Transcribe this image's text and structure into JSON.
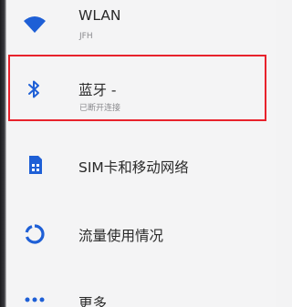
{
  "settings": {
    "items": [
      {
        "id": "wlan",
        "icon": "wifi-icon",
        "title": "WLAN",
        "subtitle": "JFH"
      },
      {
        "id": "bluetooth",
        "icon": "bluetooth-icon",
        "title": "蓝牙 -",
        "subtitle": "已断开连接"
      },
      {
        "id": "sim",
        "icon": "sim-card-icon",
        "title": "SIM卡和移动网络",
        "subtitle": ""
      },
      {
        "id": "data-usage",
        "icon": "data-usage-icon",
        "title": "流量使用情况",
        "subtitle": ""
      },
      {
        "id": "more",
        "icon": "more-icon",
        "title": "更多",
        "subtitle": ""
      }
    ]
  },
  "colors": {
    "accent": "#1e5fd6",
    "highlight_border": "#e8222c",
    "background": "#f4f4f5"
  }
}
